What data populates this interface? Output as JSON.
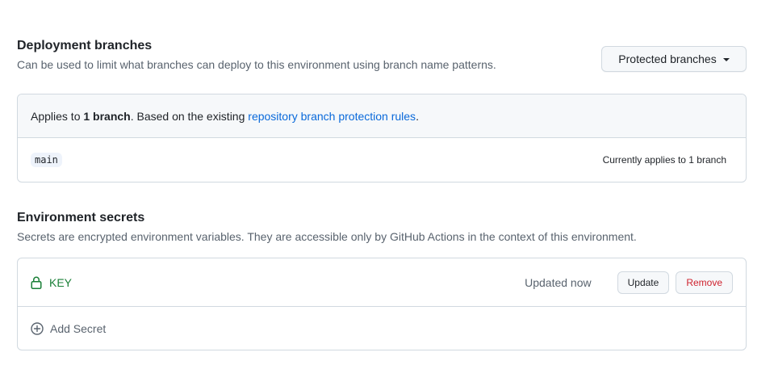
{
  "deployment": {
    "title": "Deployment branches",
    "description": "Can be used to limit what branches can deploy to this environment using branch name patterns.",
    "dropdown_label": "Protected branches",
    "applies_prefix": "Applies to ",
    "applies_count": "1 branch",
    "applies_middle": ". Based on the existing ",
    "rules_link": "repository branch protection rules",
    "applies_suffix": ".",
    "branch_name": "main",
    "branch_count_text": "Currently applies to 1 branch"
  },
  "secrets": {
    "title": "Environment secrets",
    "description": "Secrets are encrypted environment variables. They are accessible only by GitHub Actions in the context of this environment.",
    "items": [
      {
        "name": "KEY",
        "updated": "Updated now",
        "update_label": "Update",
        "remove_label": "Remove"
      }
    ],
    "add_label": "Add Secret"
  },
  "colors": {
    "link": "#0969da",
    "secret_name": "#1a7f37",
    "danger": "#cf222e",
    "muted": "#59636e"
  },
  "icons": {
    "secret": "lock-icon",
    "add": "plus-circle-icon",
    "dropdown": "triangle-down-icon"
  }
}
